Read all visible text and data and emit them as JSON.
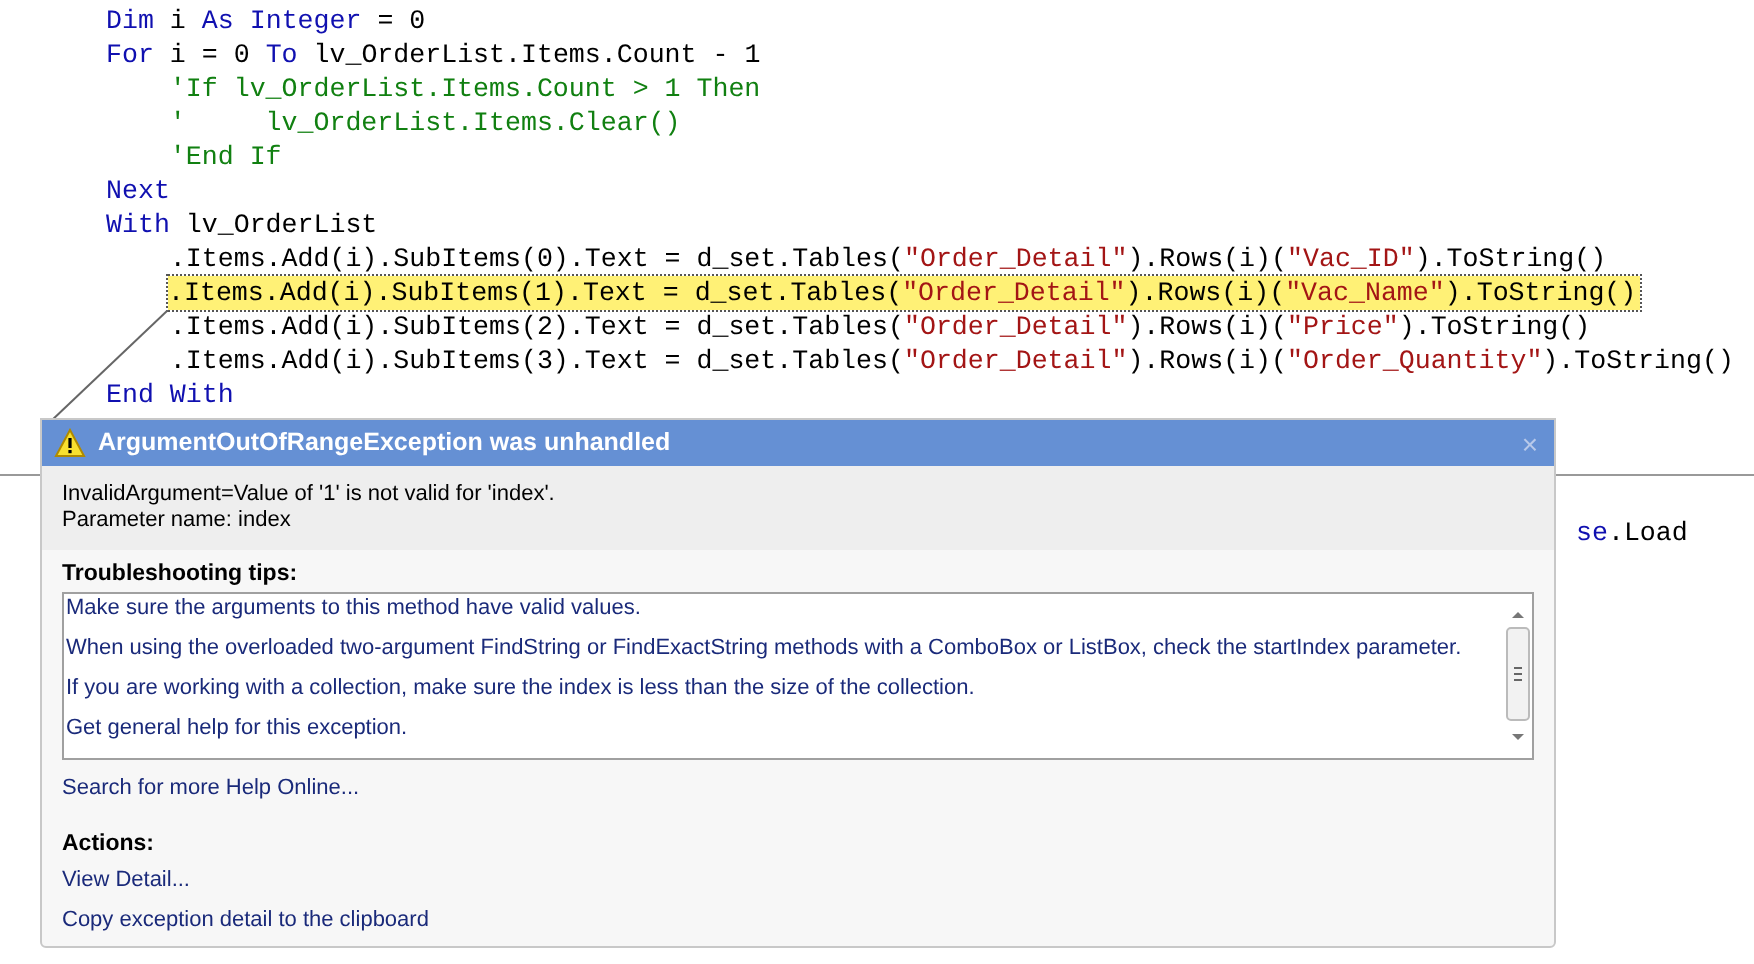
{
  "code_lines": [
    {
      "highlighted": false,
      "tokens": [
        {
          "kind": "keyword",
          "text": "Dim"
        },
        {
          "kind": "plain",
          "text": " i "
        },
        {
          "kind": "keyword",
          "text": "As"
        },
        {
          "kind": "keyword",
          "text": " Integer"
        },
        {
          "kind": "plain",
          "text": " = 0"
        }
      ]
    },
    {
      "highlighted": false,
      "tokens": [
        {
          "kind": "keyword",
          "text": "For"
        },
        {
          "kind": "plain",
          "text": " i = 0 "
        },
        {
          "kind": "keyword",
          "text": "To"
        },
        {
          "kind": "plain",
          "text": " lv_OrderList.Items.Count - 1"
        }
      ]
    },
    {
      "highlighted": false,
      "tokens": [
        {
          "kind": "comment",
          "text": "    'If lv_OrderList.Items.Count > 1 Then"
        }
      ]
    },
    {
      "highlighted": false,
      "tokens": [
        {
          "kind": "comment",
          "text": "    '     lv_OrderList.Items.Clear()"
        }
      ]
    },
    {
      "highlighted": false,
      "tokens": [
        {
          "kind": "comment",
          "text": "    'End If"
        }
      ]
    },
    {
      "highlighted": false,
      "tokens": [
        {
          "kind": "keyword",
          "text": "Next"
        }
      ]
    },
    {
      "highlighted": false,
      "tokens": [
        {
          "kind": "keyword",
          "text": "With"
        },
        {
          "kind": "plain",
          "text": " lv_OrderList"
        }
      ]
    },
    {
      "highlighted": false,
      "tokens": [
        {
          "kind": "plain",
          "text": "    .Items.Add(i).SubItems(0).Text = d_set.Tables("
        },
        {
          "kind": "string",
          "text": "\"Order_Detail\""
        },
        {
          "kind": "plain",
          "text": ").Rows(i)("
        },
        {
          "kind": "string",
          "text": "\"Vac_ID\""
        },
        {
          "kind": "plain",
          "text": ").ToString()"
        }
      ]
    },
    {
      "highlighted": true,
      "tokens": [
        {
          "kind": "plain",
          "text": ".Items.Add(i).SubItems(1).Text = d_set.Tables("
        },
        {
          "kind": "string",
          "text": "\"Order_Detail\""
        },
        {
          "kind": "plain",
          "text": ").Rows(i)("
        },
        {
          "kind": "string",
          "text": "\"Vac_Name\""
        },
        {
          "kind": "plain",
          "text": ").ToString()"
        }
      ]
    },
    {
      "highlighted": false,
      "tokens": [
        {
          "kind": "plain",
          "text": "    .Items.Add(i).SubItems(2).Text = d_set.Tables("
        },
        {
          "kind": "string",
          "text": "\"Order_Detail\""
        },
        {
          "kind": "plain",
          "text": ").Rows(i)("
        },
        {
          "kind": "string",
          "text": "\"Price\""
        },
        {
          "kind": "plain",
          "text": ").ToString()"
        }
      ]
    },
    {
      "highlighted": false,
      "tokens": [
        {
          "kind": "plain",
          "text": "    .Items.Add(i).SubItems(3).Text = d_set.Tables("
        },
        {
          "kind": "string",
          "text": "\"Order_Detail\""
        },
        {
          "kind": "plain",
          "text": ").Rows(i)("
        },
        {
          "kind": "string",
          "text": "\"Order_Quantity\""
        },
        {
          "kind": "plain",
          "text": ").ToString()"
        }
      ]
    },
    {
      "highlighted": false,
      "tokens": [
        {
          "kind": "keyword",
          "text": "End With"
        }
      ]
    }
  ],
  "partial_code_right": [
    {
      "kind": "keyword",
      "text": "se"
    },
    {
      "kind": "plain",
      "text": ".Load"
    }
  ],
  "exception_dialog": {
    "title": "ArgumentOutOfRangeException was unhandled",
    "close_glyph": "×",
    "message": [
      "InvalidArgument=Value of '1' is not valid for 'index'.",
      "Parameter name: index"
    ],
    "tips_heading": "Troubleshooting tips:",
    "tips": [
      "Make sure the arguments to this method have valid values.",
      "When using the overloaded two-argument FindString or FindExactString methods with a ComboBox or ListBox, check the startIndex parameter.",
      "If you are working with a collection, make sure the index is less than the size of the collection.",
      "Get general help for this exception."
    ],
    "help_link": "Search for more Help Online...",
    "actions_heading": "Actions:",
    "actions": [
      "View Detail...",
      "Copy exception detail to the clipboard"
    ]
  }
}
